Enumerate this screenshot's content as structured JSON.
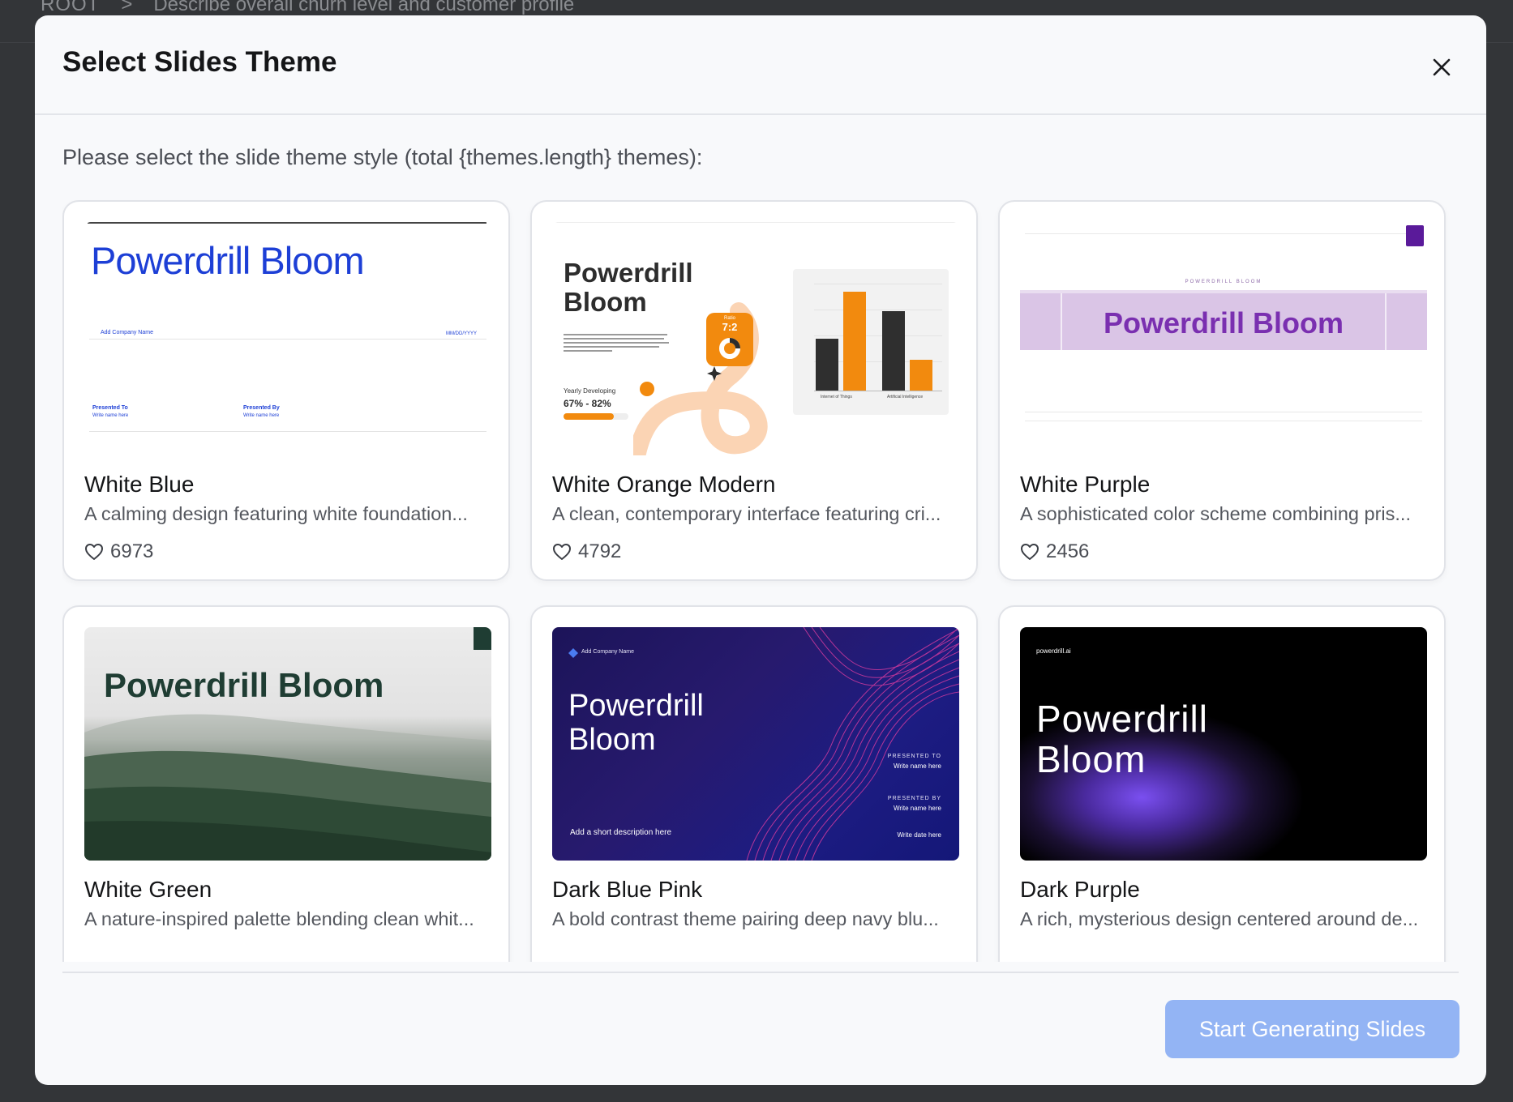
{
  "background": {
    "breadcrumb_root": "ROOT",
    "breadcrumb_separator": ">",
    "breadcrumb_current": "Describe overall churn level and customer profile"
  },
  "modal": {
    "title": "Select Slides Theme",
    "close_icon": "close-icon",
    "subtitle": "Please select the slide theme style (total {themes.length} themes):",
    "primary_button": "Start Generating Slides",
    "primary_button_color": "#93b4f4"
  },
  "themes": [
    {
      "name": "White Blue",
      "description": "A calming design featuring white foundation...",
      "likes": "6973",
      "preview": {
        "title": "Powerdrill Bloom",
        "company": "Add Company Name",
        "date": "MM/DD/YYYY",
        "presented_to": "Presented To",
        "presented_by": "Presented By",
        "write_name": "Write name here",
        "accent": "#1d3fd6"
      }
    },
    {
      "name": "White Orange Modern",
      "description": "A clean, contemporary interface featuring cri...",
      "likes": "4792",
      "preview": {
        "title_line1": "Powerdrill",
        "title_line2": "Bloom",
        "metric_label": "Yearly Developing",
        "metric_value": "67% - 82%",
        "ratio_label": "Ratio",
        "ratio": "7:2",
        "bar_label_1": "Internet of Things",
        "bar_label_2": "Artificial Intelligence",
        "accent": "#f28a0e"
      }
    },
    {
      "name": "White Purple",
      "description": "A sophisticated color scheme combining pris...",
      "likes": "2456",
      "preview": {
        "eyebrow": "POWERDRILL BLOOM",
        "title": "Powerdrill Bloom",
        "accent": "#7a2fb0"
      }
    },
    {
      "name": "White Green",
      "description": "A nature-inspired palette blending clean whit...",
      "likes": "",
      "preview": {
        "title": "Powerdrill Bloom",
        "accent": "#1f3d33"
      }
    },
    {
      "name": "Dark Blue Pink",
      "description": "A bold contrast theme pairing deep navy blu...",
      "likes": "",
      "preview": {
        "company": "Add Company Name",
        "title_line1": "Powerdrill",
        "title_line2": "Bloom",
        "presented_to": "PRESENTED TO",
        "presented_by": "PRESENTED BY",
        "write_name": "Write name here",
        "description": "Add a short description here",
        "date": "Write date here",
        "accent": "#e0399c"
      }
    },
    {
      "name": "Dark Purple",
      "description": "A rich, mysterious design centered around de...",
      "likes": "",
      "preview": {
        "brand": "powerdrill.ai",
        "title_line1": "Powerdrill",
        "title_line2": "Bloom",
        "accent": "#7a4ff0"
      }
    }
  ]
}
